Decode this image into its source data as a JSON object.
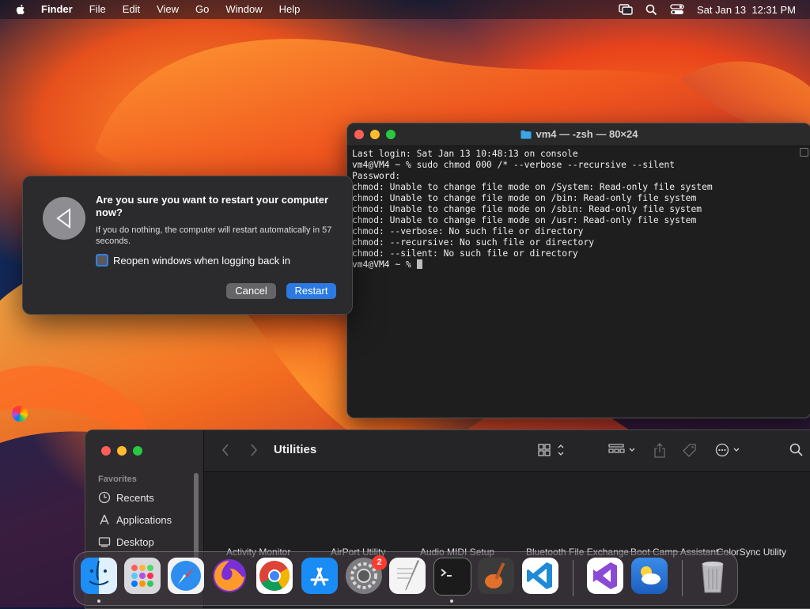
{
  "menubar": {
    "app_name": "Finder",
    "items": [
      "File",
      "Edit",
      "View",
      "Go",
      "Window",
      "Help"
    ],
    "datetime": "Sat Jan 13  12:31 PM"
  },
  "terminal": {
    "title": "vm4 — -zsh — 80×24",
    "lines": [
      "Last login: Sat Jan 13 10:48:13 on console",
      "vm4@VM4 ~ % sudo chmod 000 /* --verbose --recursive --silent",
      "Password:",
      "chmod: Unable to change file mode on /System: Read-only file system",
      "chmod: Unable to change file mode on /bin: Read-only file system",
      "chmod: Unable to change file mode on /sbin: Read-only file system",
      "chmod: Unable to change file mode on /usr: Read-only file system",
      "chmod: --verbose: No such file or directory",
      "chmod: --recursive: No such file or directory",
      "chmod: --silent: No such file or directory"
    ],
    "prompt": "vm4@VM4 ~ % "
  },
  "dialog": {
    "title": "Are you sure you want to restart your computer now?",
    "message": "If you do nothing, the computer will restart automatically in 57 seconds.",
    "checkbox_label": "Reopen windows when logging back in",
    "checkbox_checked": false,
    "cancel_label": "Cancel",
    "restart_label": "Restart"
  },
  "finder": {
    "title": "Utilities",
    "sidebar_section": "Favorites",
    "sidebar_items": [
      "Recents",
      "Applications",
      "Desktop"
    ],
    "files_visible": [
      "Activity Monitor",
      "AirPort Utility",
      "Audio MIDI Setup",
      "Bluetooth File Exchange",
      "Boot Camp Assistant",
      "ColorSync Utility"
    ]
  },
  "dock": {
    "apps": [
      {
        "name": "Finder",
        "color": "#1e8ef7",
        "running": true
      },
      {
        "name": "Launchpad",
        "color": "#c9c9c9",
        "running": false
      },
      {
        "name": "Safari",
        "color": "#2d8ef0",
        "running": false
      },
      {
        "name": "Firefox",
        "color": "#8a2be2",
        "running": false
      },
      {
        "name": "Chrome",
        "color": "#ffffff",
        "running": false
      },
      {
        "name": "App Store",
        "color": "#1a8cf5",
        "running": false
      },
      {
        "name": "System Settings",
        "color": "#7c7c80",
        "running": false,
        "badge": "2"
      },
      {
        "name": "TextEdit",
        "color": "#f4f4f4",
        "running": false
      },
      {
        "name": "Terminal",
        "color": "#1b1b1b",
        "running": true
      },
      {
        "name": "GarageBand",
        "color": "#3b3b3b",
        "running": false
      },
      {
        "name": "VS Code",
        "color": "#ffffff",
        "running": false
      },
      {
        "name": "Visual Studio",
        "color": "#ffffff",
        "running": false
      },
      {
        "name": "Weather",
        "color": "#2a7ad8",
        "running": false
      },
      {
        "name": "Trash",
        "color": "#9a9a9a",
        "running": false
      }
    ]
  },
  "colors": {
    "accent": "#2b7ae3",
    "traffic_red": "#ff5f57",
    "traffic_yellow": "#febc2e",
    "traffic_green": "#28c840"
  }
}
